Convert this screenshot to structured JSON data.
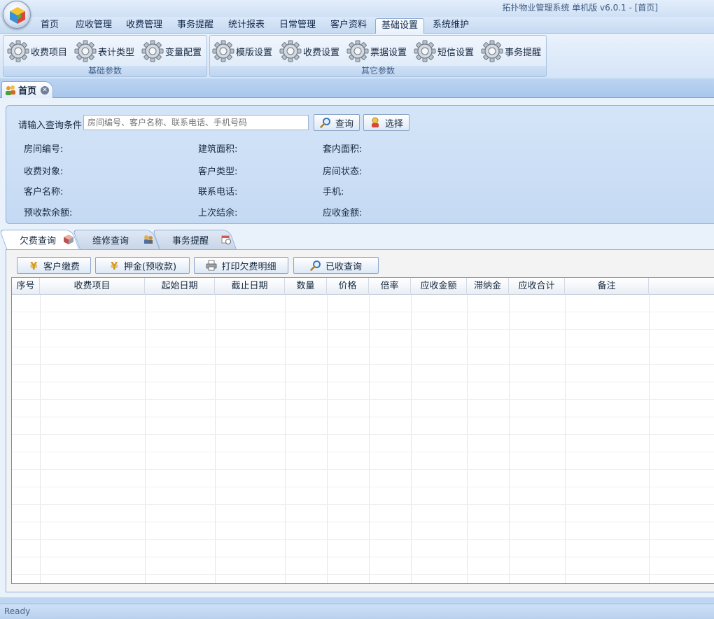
{
  "window": {
    "title": "拓扑物业管理系统  单机版 v6.0.1 - [首页]"
  },
  "menu": {
    "items": [
      "首页",
      "应收管理",
      "收费管理",
      "事务提醒",
      "统计报表",
      "日常管理",
      "客户资料",
      "基础设置",
      "系统维护"
    ],
    "active": "基础设置"
  },
  "ribbon": {
    "groups": [
      {
        "label": "基础参数",
        "buttons": [
          "收费项目",
          "表计类型",
          "变量配置"
        ]
      },
      {
        "label": "其它参数",
        "buttons": [
          "模版设置",
          "收费设置",
          "票据设置",
          "短信设置",
          "事务提醒"
        ]
      }
    ]
  },
  "doc_tab": {
    "label": "首页"
  },
  "query": {
    "label": "请输入查询条件",
    "placeholder": "房间编号、客户名称、联系电话、手机号码",
    "search_button": "查询",
    "select_button": "选择",
    "fields": {
      "room_no": "房间编号:",
      "building_area": "建筑面积:",
      "inner_area": "套内面积:",
      "charge_target": "收费对象:",
      "customer_type": "客户类型:",
      "room_status": "房间状态:",
      "customer_name": "客户名称:",
      "phone": "联系电话:",
      "mobile": "手机:",
      "prepay_balance": "预收款余额:",
      "last_balance": "上次结余:",
      "receivable": "应收金额:"
    }
  },
  "tabs": {
    "arrears": "欠费查询",
    "repair": "维修查询",
    "reminder": "事务提醒"
  },
  "toolbar": {
    "pay": "客户缴费",
    "deposit": "押金(预收款)",
    "print": "打印欠费明细",
    "paid_query": "已收查询"
  },
  "grid": {
    "columns": [
      "序号",
      "收费项目",
      "起始日期",
      "截止日期",
      "数量",
      "价格",
      "倍率",
      "应收金额",
      "滞纳金",
      "应收合计",
      "备注"
    ]
  },
  "status": {
    "text": "Ready"
  }
}
